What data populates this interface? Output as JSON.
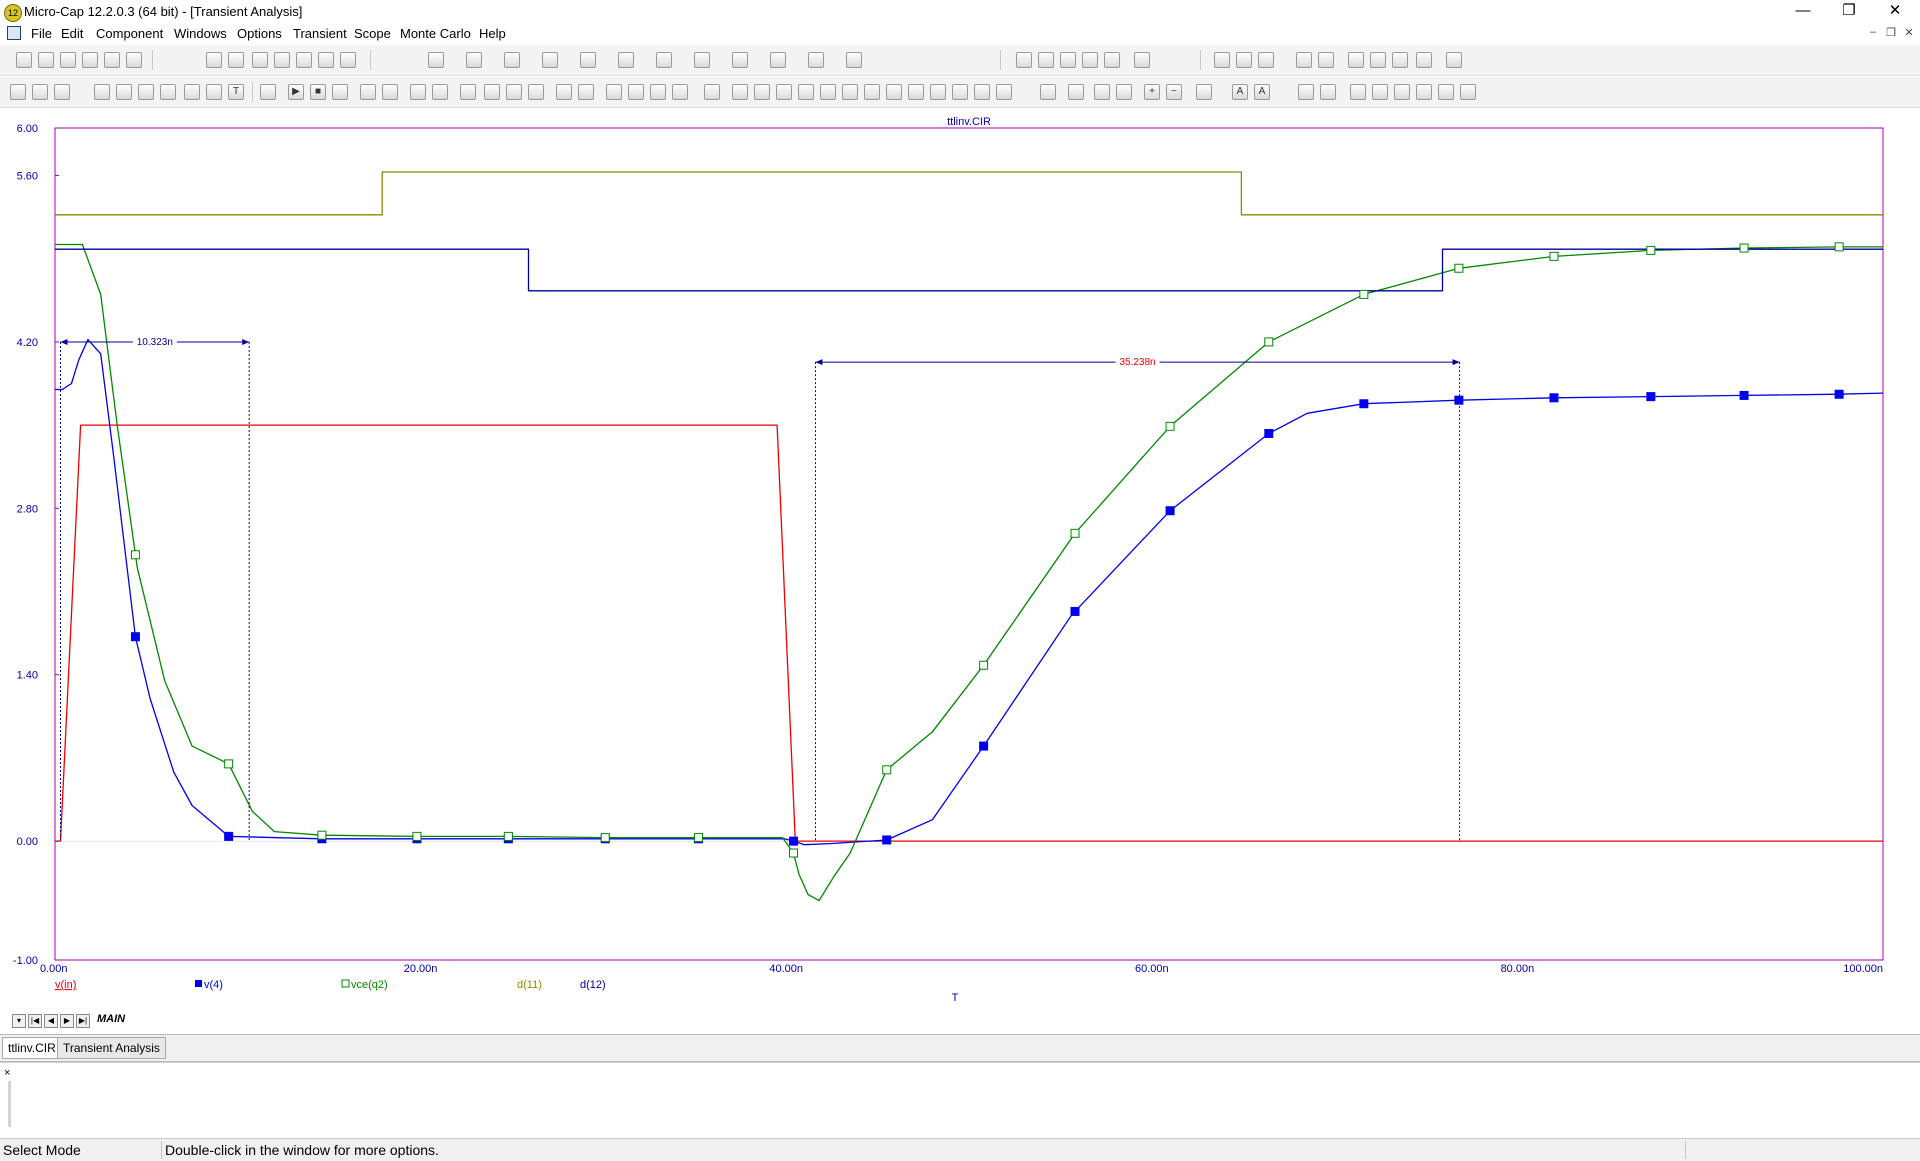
{
  "window": {
    "app_icon_text": "12",
    "title": "Micro-Cap 12.2.0.3 (64 bit) - [Transient Analysis]",
    "minimize": "—",
    "restore": "❐",
    "close": "✕"
  },
  "menu": {
    "items": [
      "File",
      "Edit",
      "Component",
      "Windows",
      "Options",
      "Transient",
      "Scope",
      "Monte Carlo",
      "Help"
    ],
    "mdi_minimize": "–",
    "mdi_restore": "❐",
    "mdi_close": "✕"
  },
  "plot": {
    "title": "ttlinv.CIR",
    "x_axis_label": "T",
    "measure_left": "10.323n",
    "measure_right": "35.238n"
  },
  "chart_data": {
    "type": "line",
    "title": "ttlinv.CIR",
    "xlabel": "T",
    "ylabel": "",
    "xlim": [
      0,
      100
    ],
    "ylim": [
      -1.0,
      6.0
    ],
    "x_unit": "ns",
    "x_ticks": [
      0,
      20,
      40,
      60,
      80,
      100
    ],
    "x_tick_labels": [
      "0.00n",
      "20.00n",
      "40.00n",
      "60.00n",
      "80.00n",
      "100.00n"
    ],
    "y_ticks": [
      6.0,
      5.6,
      4.2,
      2.8,
      1.4,
      0.0,
      -1.0
    ],
    "y_tick_labels": [
      "6.00",
      "5.60",
      "4.20",
      "2.80",
      "1.40",
      "0.00",
      "-1.00"
    ],
    "grid": false,
    "legend_position": "bottom",
    "series": [
      {
        "name": "v(in)",
        "color": "#ee0000",
        "marker": "none",
        "x": [
          0,
          0.3,
          1.4,
          39.5,
          40.5,
          100
        ],
        "y": [
          0,
          0,
          3.5,
          3.5,
          0,
          0
        ]
      },
      {
        "name": "v(4)",
        "color": "#0000ee",
        "marker": "filled-square",
        "x": [
          0,
          0.4,
          0.9,
          1.3,
          1.8,
          2.5,
          3.2,
          4.4,
          5.2,
          6.5,
          7.5,
          9.5,
          14.6,
          19.8,
          24.8,
          30.1,
          35.2,
          39.9,
          40.4,
          41.0,
          42.5,
          45.5,
          48.0,
          50.8,
          55.6,
          61.0,
          66.4,
          68.5,
          71.6,
          76.8,
          82.0,
          87.3,
          92.4,
          97.6,
          100
        ],
        "y": [
          3.8,
          3.8,
          3.85,
          4.05,
          4.22,
          4.1,
          3.25,
          1.72,
          1.2,
          0.58,
          0.3,
          0.04,
          0.02,
          0.02,
          0.02,
          0.02,
          0.02,
          0.02,
          0.0,
          -0.03,
          -0.02,
          0.01,
          0.18,
          0.8,
          1.9,
          2.78,
          3.43,
          3.6,
          3.68,
          3.71,
          3.73,
          3.74,
          3.75,
          3.76,
          3.77
        ]
      },
      {
        "name": "vce(q2)",
        "color": "#008800",
        "marker": "open-square",
        "x": [
          0,
          0.8,
          1.5,
          2.5,
          3.4,
          4.5,
          6.0,
          7.5,
          9.5,
          10.8,
          12.0,
          14.6,
          19.8,
          24.8,
          30.1,
          35.2,
          39.8,
          40.4,
          40.7,
          41.2,
          41.8,
          42.6,
          43.5,
          45.5,
          48.0,
          50.8,
          55.8,
          61.0,
          66.4,
          71.6,
          76.8,
          82.0,
          87.3,
          92.4,
          97.6,
          100
        ],
        "y": [
          5.02,
          5.02,
          5.02,
          4.6,
          3.5,
          2.3,
          1.35,
          0.8,
          0.65,
          0.25,
          0.08,
          0.05,
          0.04,
          0.04,
          0.03,
          0.03,
          0.03,
          -0.1,
          -0.28,
          -0.45,
          -0.5,
          -0.3,
          -0.1,
          0.6,
          0.92,
          1.48,
          2.59,
          3.49,
          4.2,
          4.6,
          4.82,
          4.92,
          4.97,
          4.99,
          5.0,
          5.0
        ]
      },
      {
        "name": "d(11)",
        "color": "#8a8a00",
        "marker": "none",
        "x": [
          0,
          17.9,
          17.9,
          64.9,
          64.9,
          100
        ],
        "y": [
          5.27,
          5.27,
          5.63,
          5.63,
          5.27,
          5.27
        ]
      },
      {
        "name": "d(12)",
        "color": "#000099",
        "marker": "none",
        "x": [
          0,
          25.9,
          25.9,
          75.9,
          75.9,
          100
        ],
        "y": [
          4.98,
          4.98,
          4.63,
          4.63,
          4.98,
          4.98
        ]
      }
    ],
    "annotations": [
      {
        "text": "10.323n",
        "x_start": 0.3,
        "x_end": 10.623,
        "y": 4.2,
        "color": "#000099"
      },
      {
        "text": "35.238n",
        "x_start": 41.6,
        "x_end": 76.838,
        "y": 4.03,
        "color": "#ee0000"
      }
    ]
  },
  "sheets": {
    "active": "MAIN",
    "nav": [
      "▾",
      "|◀",
      "◀",
      "▶",
      "▶|"
    ]
  },
  "doc_tabs": [
    "ttlinv.CIR",
    "Transient Analysis"
  ],
  "output_pane": {
    "close": "×"
  },
  "status": {
    "mode": "Select Mode",
    "hint": "Double-click in the window for more options."
  }
}
